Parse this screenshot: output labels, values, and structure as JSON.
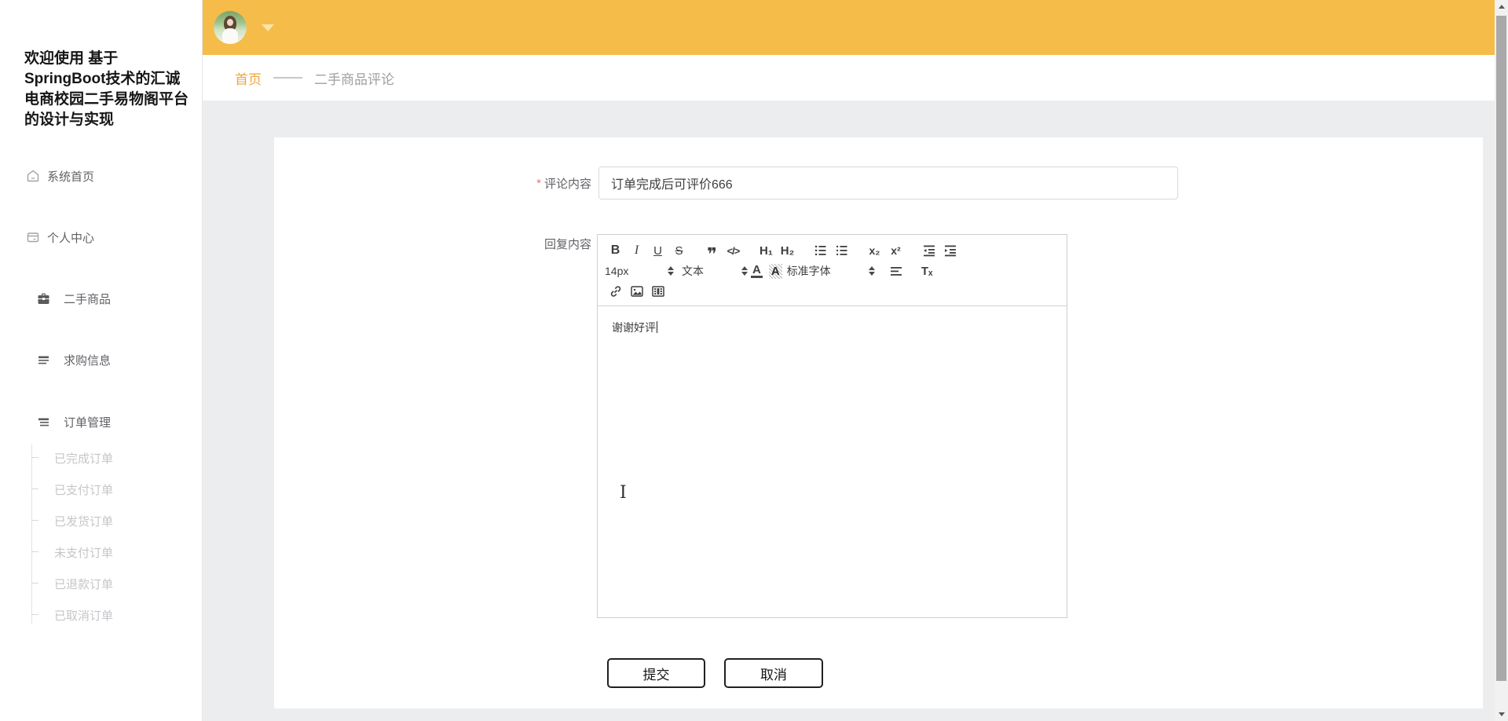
{
  "sidebar": {
    "title_lines": [
      "欢迎使用 基于",
      "SpringBoot技术的汇诚",
      "电商校园二手易物阁平台",
      "的设计与实现"
    ],
    "items": [
      "系统首页",
      "个人中心",
      "二手商品",
      "求购信息",
      "订单管理"
    ],
    "order_children": [
      "已完成订单",
      "已支付订单",
      "已发货订单",
      "未支付订单",
      "已退款订单",
      "已取消订单"
    ]
  },
  "breadcrumb": {
    "home": "首页",
    "current": "二手商品评论"
  },
  "form": {
    "required_mark": "*",
    "comment_label": "评论内容",
    "comment_value": "订单完成后可评价666",
    "reply_label": "回复内容",
    "submit_label": "提交",
    "cancel_label": "取消"
  },
  "editor": {
    "toolbar": {
      "bold": "B",
      "italic": "I",
      "underline": "U",
      "strike": "S",
      "quote": "❞",
      "code": "</>",
      "h1": "H₁",
      "h2": "H₂",
      "subscript": "x₂",
      "superscript": "x²",
      "size_value": "14px",
      "header_value": "文本",
      "color_letter": "A",
      "background_letter": "A",
      "font_value": "标准字体",
      "clean": "Tₓ"
    },
    "content": "谢谢好评"
  },
  "icons": {
    "sidebar": [
      "home-icon",
      "card-icon",
      "briefcase-icon",
      "list-icon",
      "list-icon"
    ],
    "toolbar_svg": [
      "ordered-list-icon",
      "bullet-list-icon",
      "outdent-icon",
      "indent-icon",
      "align-icon",
      "link-icon",
      "image-icon",
      "video-icon"
    ],
    "other": [
      "avatar-dropdown-caret",
      "scrollbar-up-arrow",
      "scrollbar-down-arrow",
      "text-ibeam-cursor"
    ]
  },
  "colors": {
    "topbar": "#F5BC4A",
    "breadcrumb_active": "#F2A33C",
    "content_bg": "#ECEDEE",
    "required": "#F56C6C",
    "sub_item_text": "#C4C6C9",
    "nav_text": "#606266",
    "button_border": "#202020",
    "scrollbar_thumb": "#A9A9A9"
  }
}
